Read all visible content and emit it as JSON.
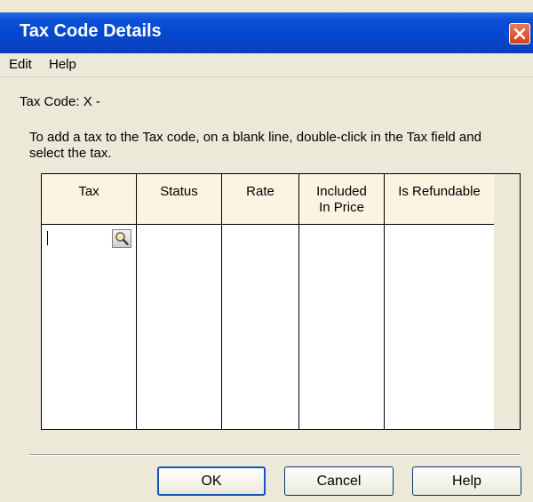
{
  "window": {
    "title": "Tax Code Details"
  },
  "menu": [
    {
      "label": "Edit"
    },
    {
      "label": "Help"
    }
  ],
  "tax_code_label": "Tax Code: X -",
  "instructions": "To add a tax to the Tax code, on a blank line, double-click in the Tax field and select the tax.",
  "table": {
    "columns": [
      {
        "header": "Tax"
      },
      {
        "header": "Status"
      },
      {
        "header": "Rate"
      },
      {
        "header": "Included In Price"
      },
      {
        "header": "Is Refundable"
      }
    ],
    "rows": []
  },
  "icons": {
    "lookup": "magnifier-icon",
    "close": "close-icon"
  },
  "buttons": {
    "ok": "OK",
    "cancel": "Cancel",
    "help": "Help"
  },
  "colors": {
    "titlebar": "#0547cf",
    "header_bg": "#fbf4e3",
    "close": "#d1401d"
  }
}
